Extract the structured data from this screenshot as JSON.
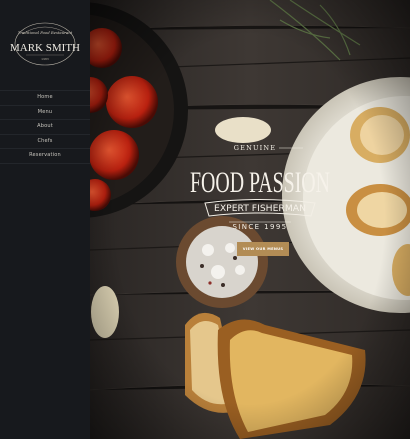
{
  "brand": {
    "script_top": "Traditional Food Restaurant",
    "name": "MARK SMITH",
    "sub": "1983"
  },
  "nav": {
    "items": [
      {
        "label": "Home"
      },
      {
        "label": "Menu"
      },
      {
        "label": "About"
      },
      {
        "label": "Chefs"
      },
      {
        "label": "Reservation"
      }
    ]
  },
  "hero": {
    "genuine": "GENUINE",
    "headline": "FOOD PASSION",
    "ribbon": "EXPERT FISHERMAN",
    "since": "SINCE 1995",
    "cta_label": "VIEW OUR MENUS"
  },
  "colors": {
    "sidebar": "#17191d",
    "accent": "#b28c55",
    "wood": "#3a3532"
  }
}
